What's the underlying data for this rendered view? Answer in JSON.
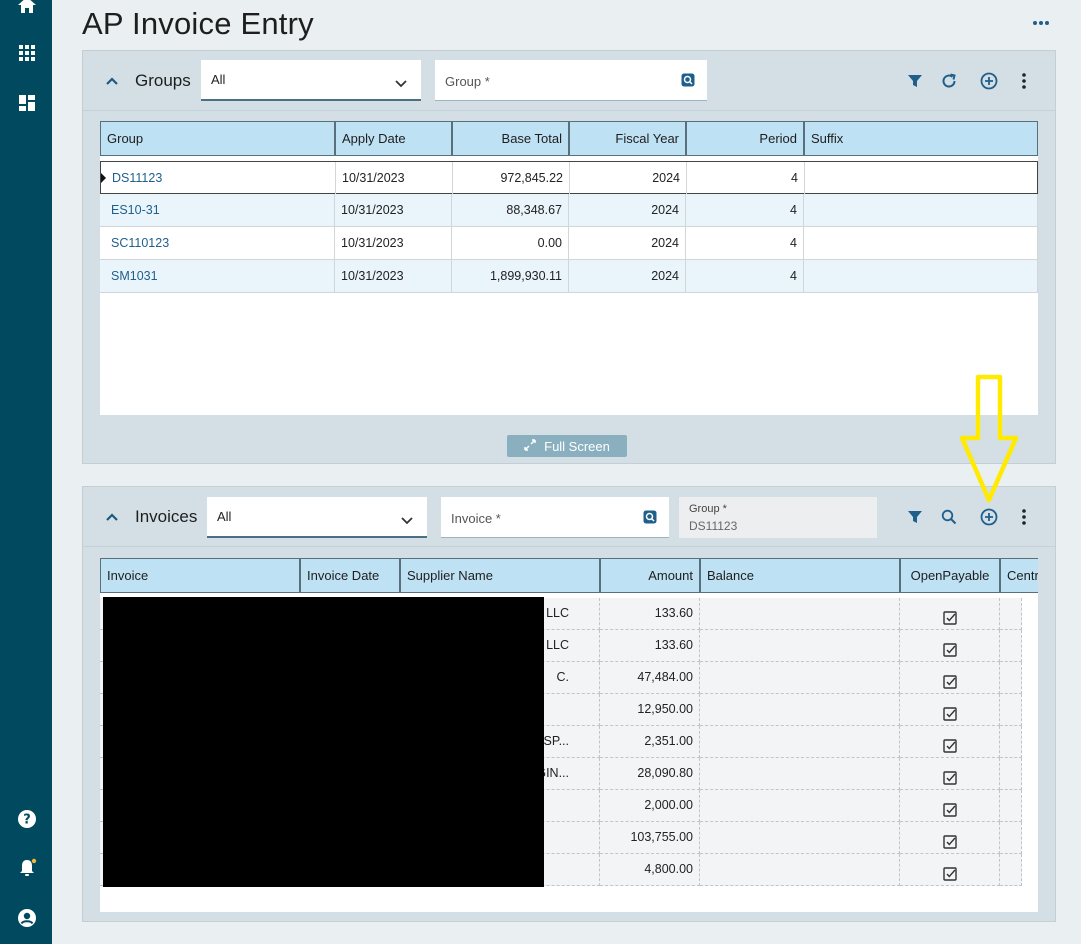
{
  "page": {
    "title": "AP Invoice Entry"
  },
  "colors": {
    "sidebar": "#00495e",
    "accent": "#1f5f8b",
    "header_cell": "#bfe1f4",
    "annotation": "#ffea00"
  },
  "sidebar": {
    "top_icons": [
      "home-icon",
      "apps-grid-icon",
      "dashboard-icon"
    ],
    "bottom_icons": [
      "help-icon",
      "notification-bell-icon",
      "user-account-icon"
    ]
  },
  "groups": {
    "label": "Groups",
    "filter_value": "All",
    "search_placeholder": "Group *",
    "columns": [
      "Group",
      "Apply Date",
      "Base Total",
      "Fiscal Year",
      "Period",
      "Suffix"
    ],
    "rows": [
      [
        "DS11123",
        "10/31/2023",
        "972,845.22",
        "2024",
        "4",
        ""
      ],
      [
        "ES10-31",
        "10/31/2023",
        "88,348.67",
        "2024",
        "4",
        ""
      ],
      [
        "SC110123",
        "10/31/2023",
        "0.00",
        "2024",
        "4",
        ""
      ],
      [
        "SM1031",
        "10/31/2023",
        "1,899,930.11",
        "2024",
        "4",
        ""
      ]
    ],
    "fullscreen_label": "Full Screen"
  },
  "invoices": {
    "label": "Invoices",
    "filter_value": "All",
    "search_placeholder": "Invoice *",
    "group_field_label": "Group *",
    "group_field_value": "DS11123",
    "columns": [
      "Invoice",
      "Invoice Date",
      "Supplier Name",
      "Amount",
      "Balance",
      "OpenPayable",
      "Centr"
    ],
    "rows": [
      {
        "supplier_tail": "LLC",
        "amount": "133.60",
        "open_payable": true
      },
      {
        "supplier_tail": "LLC",
        "amount": "133.60",
        "open_payable": true
      },
      {
        "supplier_tail": "C.",
        "amount": "47,484.00",
        "open_payable": true
      },
      {
        "supplier_tail": "",
        "amount": "12,950.00",
        "open_payable": true
      },
      {
        "supplier_tail": "RANSP...",
        "amount": "2,351.00",
        "open_payable": true
      },
      {
        "supplier_tail": "NGIN...",
        "amount": "28,090.80",
        "open_payable": true
      },
      {
        "supplier_tail": "",
        "amount": "2,000.00",
        "open_payable": true
      },
      {
        "supplier_tail": "",
        "amount": "103,755.00",
        "open_payable": true
      },
      {
        "supplier_tail": "",
        "amount": "4,800.00",
        "open_payable": true
      }
    ]
  }
}
